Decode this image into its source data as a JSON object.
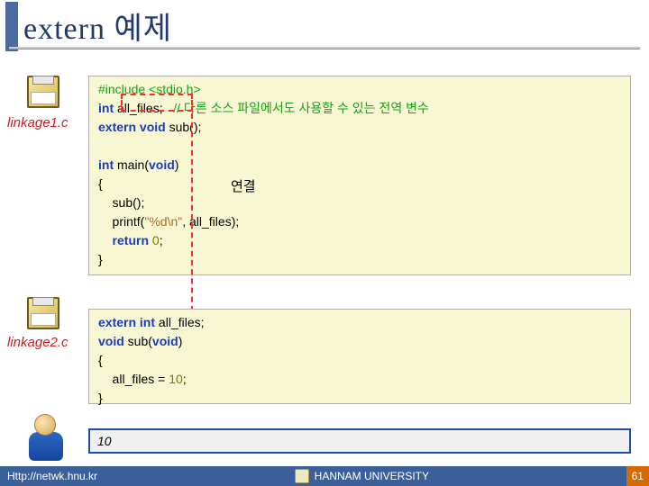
{
  "title": "extern 예제",
  "labels": {
    "file1": "linkage1.c",
    "file2": "linkage2.c",
    "connect": "연결"
  },
  "code1": {
    "l1_pp": "#include",
    "l1_lib": " <stdio.h>",
    "l2_ty": "int",
    "l2_id": " all_files;",
    "l2_cm": "   // 다른 소스 파일에서도 사용할 수 있는 전역 변수",
    "l3_kw": "extern",
    "l3_ty": " void",
    "l3_id": " sub();",
    "l5_ty": "int",
    "l5_id": " main(",
    "l5_ty2": "void",
    "l5_id2": ")",
    "l6": "{",
    "l7": "    sub();",
    "l8a": "    printf(",
    "l8_str": "\"%d\\n\"",
    "l8b": ", all_files);",
    "l9_kw": "    return",
    "l9_num": " 0",
    "l9_sc": ";",
    "l10": "}"
  },
  "code2": {
    "l1_kw": "extern",
    "l1_ty": " int",
    "l1_id": " all_files;",
    "l2_ty": "void",
    "l2_id": " sub(",
    "l2_ty2": "void",
    "l2_id2": ")",
    "l3": "{",
    "l4a": "    all_files = ",
    "l4_num": "10",
    "l4b": ";",
    "l5": "}"
  },
  "output": "10",
  "footer": {
    "url": "Http://netwk.hnu.kr",
    "uni": "HANNAM  UNIVERSITY",
    "page": "61"
  }
}
